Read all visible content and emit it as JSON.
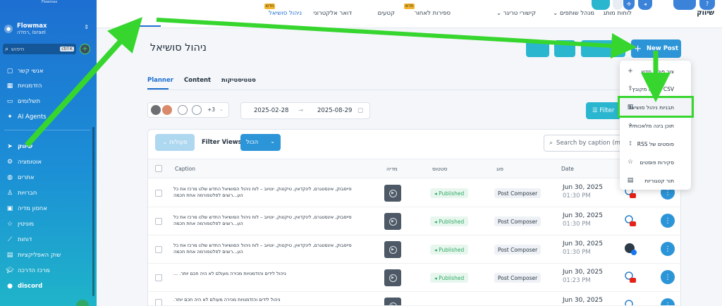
{
  "sidebar": {
    "logo": "Flowmax",
    "account": {
      "name": "Flowmax",
      "location": "רמלה, Israel"
    },
    "search": {
      "placeholder": "חיפוש",
      "shortcut": "ctrl K"
    },
    "items": [
      {
        "label": "אנשי קשר",
        "icon": "contacts-icon"
      },
      {
        "label": "הזדמנויות",
        "icon": "opportunities-icon"
      },
      {
        "label": "תשלומים",
        "icon": "payments-icon"
      },
      {
        "label": "AI Agents",
        "icon": "ai-icon"
      },
      {
        "label": "שיווק",
        "icon": "send-icon"
      },
      {
        "label": "אוטומציה",
        "icon": "automation-icon"
      },
      {
        "label": "אתרים",
        "icon": "globe-icon"
      },
      {
        "label": "חברויות",
        "icon": "memberships-icon"
      },
      {
        "label": "אחסון מדיה",
        "icon": "image-icon"
      },
      {
        "label": "מוניטין",
        "icon": "star-icon"
      },
      {
        "label": "דוחות",
        "icon": "chart-icon"
      },
      {
        "label": "שוק האפליקציות",
        "icon": "apps-icon"
      },
      {
        "label": "מרכז הדרכה",
        "icon": "graduation-icon"
      },
      {
        "label": "discord",
        "icon": "discord-icon"
      }
    ]
  },
  "topnav": {
    "brand": "שיווק",
    "items": [
      {
        "label": "ניהול סושיאל",
        "active": true
      },
      {
        "label": "דואר אלקטרוני",
        "active": false
      },
      {
        "label": "קטעים",
        "active": false
      },
      {
        "label": "ספירות לאחור",
        "active": false,
        "badge": "חדש"
      },
      {
        "label": "קישורי טריגר",
        "active": false,
        "chevron": true
      },
      {
        "label": "מנהל שותפים",
        "active": false,
        "chevron": true
      },
      {
        "label": "לוחות מותג",
        "active": false,
        "badge": "חדש"
      }
    ]
  },
  "page": {
    "title": "ניהול סושיאל",
    "new_post_label": "New Post",
    "tabs": [
      {
        "label": "Planner",
        "active": true
      },
      {
        "label": "Content",
        "active": false
      },
      {
        "label": "סטטיסטיקות",
        "active": false
      }
    ],
    "accounts_more": "+3",
    "date_from": "2025-02-28",
    "date_to": "2025-08-29",
    "filters_label": "Filter",
    "actions_label": "פעולות",
    "filter_views_label": "Filter Views:",
    "filter_views_value": "הכול",
    "search_placeholder": "Search by caption (mi"
  },
  "table": {
    "headers": {
      "caption": "Caption",
      "media": "מדיה",
      "status": "סטטוס",
      "type": "סוג",
      "date": "Date"
    },
    "rows": [
      {
        "caption": "פייסבוק, אינסטגרם, לינקדאין, טיקטוק, יוטיוב – לוח ניהול הסושיאל החדש שלנו מרכז את כל הע...רוצים לפלטפורמה אחת חכמה",
        "status": "Published",
        "type": "Post Composer",
        "date": "Jun 30, 2025",
        "time": "01:30 PM",
        "platform": "youtube"
      },
      {
        "caption": "פייסבוק, אינסטגרם, לינקדאין, טיקטוק, יוטיוב – לוח ניהול הסושיאל החדש שלנו מרכז את כל הע...רוצים לפלטפורמה אחת חכמה",
        "status": "Published",
        "type": "Post Composer",
        "date": "Jun 30, 2025",
        "time": "01:30 PM",
        "platform": "youtube"
      },
      {
        "caption": "פייסבוק, אינסטגרם, לינקדאין, טיקטוק, יוטיוב – לוח ניהול הסושיאל החדש שלנו מרכז את כל הע...רוצים לפלטפורמה אחת חכמה",
        "status": "Published",
        "type": "Post Composer",
        "date": "Jun 30, 2025",
        "time": "01:30 PM",
        "platform": "facebook"
      },
      {
        "caption": "ניהול לידים והזדמנויות מכירה מעולם לא היה חכם יותר. ...",
        "status": "Published",
        "type": "Post Composer",
        "date": "Jun 30, 2025",
        "time": "01:23 PM",
        "platform": "youtube"
      },
      {
        "caption": "ניהול לידים והזדמנויות מכירה מעולם לא היה חכם יותר.",
        "status": "Published",
        "type": "Post Composer",
        "date": "Jun 30, 2025",
        "time": "",
        "platform": "youtube"
      }
    ]
  },
  "dropdown": {
    "items": [
      {
        "label": "צור פוסט חדש",
        "icon": "plus-icon"
      },
      {
        "label": "העלה מקובץ CSV",
        "icon": "upload-icon"
      },
      {
        "label": "תבניות ניהול סושיאל",
        "icon": "template-icon",
        "highlighted": true
      },
      {
        "label": "תוכן בינה מלאכותית",
        "icon": "sparkle-icon"
      },
      {
        "label": "RSS פוסטים של",
        "icon": "rss-icon"
      },
      {
        "label": "סקירות פוסטים",
        "icon": "star-icon"
      },
      {
        "label": "תור קטגוריות",
        "icon": "queue-icon"
      }
    ]
  },
  "colors": {
    "primary": "#2c95d8",
    "accent_green": "#36d62f",
    "published": "#2fa866"
  }
}
